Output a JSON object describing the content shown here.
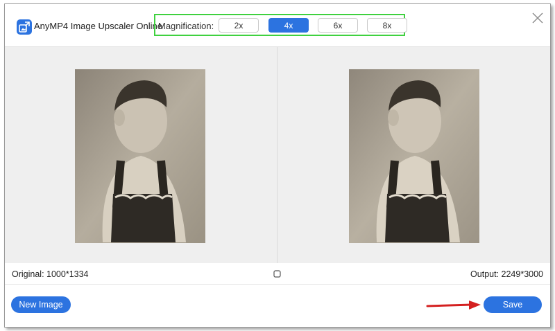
{
  "app": {
    "title": "AnyMP4 Image Upscaler Online",
    "logo_icon": "image-upscale-icon",
    "accent": "#2c73e0"
  },
  "magnification": {
    "label": "Magnification:",
    "options": [
      "2x",
      "4x",
      "6x",
      "8x"
    ],
    "selected": "4x",
    "highlight_color": "#3fd13f"
  },
  "close": {
    "icon": "close-icon"
  },
  "preview": {
    "original_image": "sepia-child-photo-original",
    "output_image": "sepia-child-photo-upscaled"
  },
  "info": {
    "original": "Original: 1000*1334",
    "output": "Output: 2249*3000",
    "compare_icon": "compare-square-icon"
  },
  "footer": {
    "new_image_label": "New Image",
    "save_label": "Save",
    "arrow_color": "#d42020"
  }
}
